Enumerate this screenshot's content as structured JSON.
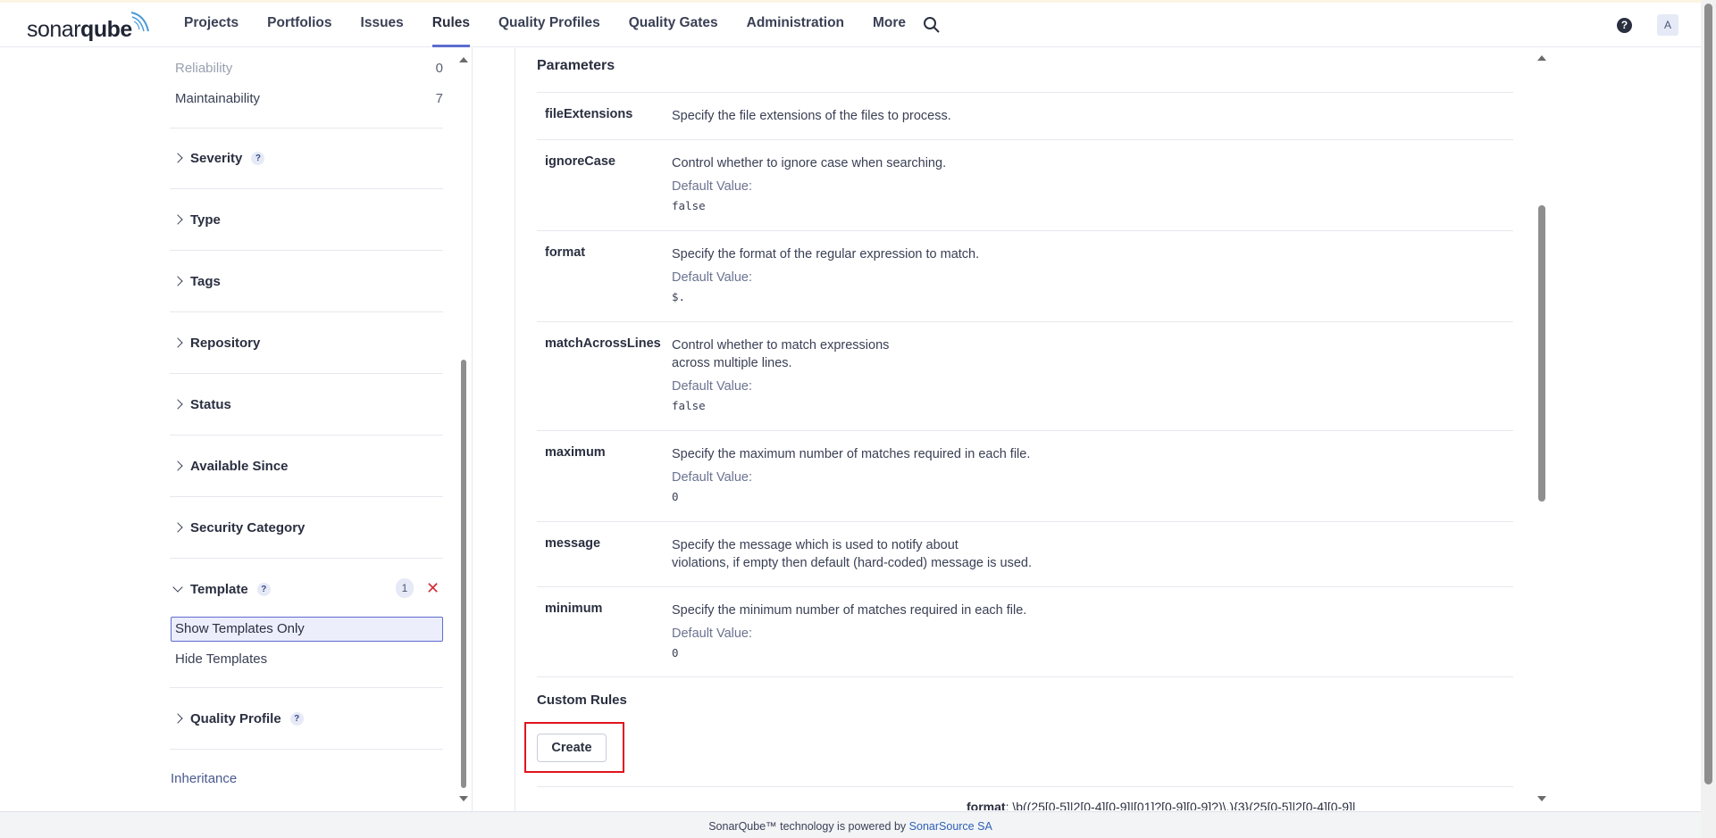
{
  "nav": {
    "logo_a": "sonar",
    "logo_b": "qube",
    "items": [
      "Projects",
      "Portfolios",
      "Issues",
      "Rules",
      "Quality Profiles",
      "Quality Gates",
      "Administration",
      "More"
    ],
    "active": "Rules",
    "help_glyph": "?",
    "avatar_letter": "A"
  },
  "sidebar": {
    "reliability": {
      "label": "Reliability",
      "count": "0"
    },
    "maintainability": {
      "label": "Maintainability",
      "count": "7"
    },
    "facets": {
      "severity": "Severity",
      "type": "Type",
      "tags": "Tags",
      "repository": "Repository",
      "status": "Status",
      "available_since": "Available Since",
      "security_category": "Security Category",
      "template": "Template",
      "quality_profile": "Quality Profile"
    },
    "template_count": "1",
    "template_options": {
      "selected": "Show Templates Only",
      "other": "Hide Templates"
    },
    "inheritance": "Inheritance",
    "help_glyph": "?",
    "clear_glyph": "✕"
  },
  "main": {
    "parameters_title": "Parameters",
    "default_label": "Default Value:",
    "params": [
      {
        "name": "fileExtensions",
        "desc": [
          "Specify the file extensions of the files to process."
        ],
        "default": ""
      },
      {
        "name": "ignoreCase",
        "desc": [
          "Control whether to ignore case when searching."
        ],
        "default": "false"
      },
      {
        "name": "format",
        "desc": [
          "Specify the format of the regular expression to match."
        ],
        "default": "$."
      },
      {
        "name": "matchAcrossLines",
        "desc": [
          "Control whether to match expressions",
          "across multiple lines."
        ],
        "default": "false"
      },
      {
        "name": "maximum",
        "desc": [
          "Specify the maximum number of matches required in each file."
        ],
        "default": "0"
      },
      {
        "name": "message",
        "desc": [
          "Specify the message which is used to notify about",
          "violations, if empty then default (hard-coded) message is used."
        ],
        "default": ""
      },
      {
        "name": "minimum",
        "desc": [
          "Specify the minimum number of matches required in each file."
        ],
        "default": "0"
      }
    ],
    "custom_rules_title": "Custom Rules",
    "create_button": "Create",
    "snippet_key": "format",
    "snippet_value": ": \\b((25[0-5]|2[0-4][0-9]|[01]?[0-9][0-9]?)\\.){3}(25[0-5]|2[0-4][0-9]|"
  },
  "footer": {
    "text": "SonarQube™ technology is powered by ",
    "link": "SonarSource SA"
  }
}
